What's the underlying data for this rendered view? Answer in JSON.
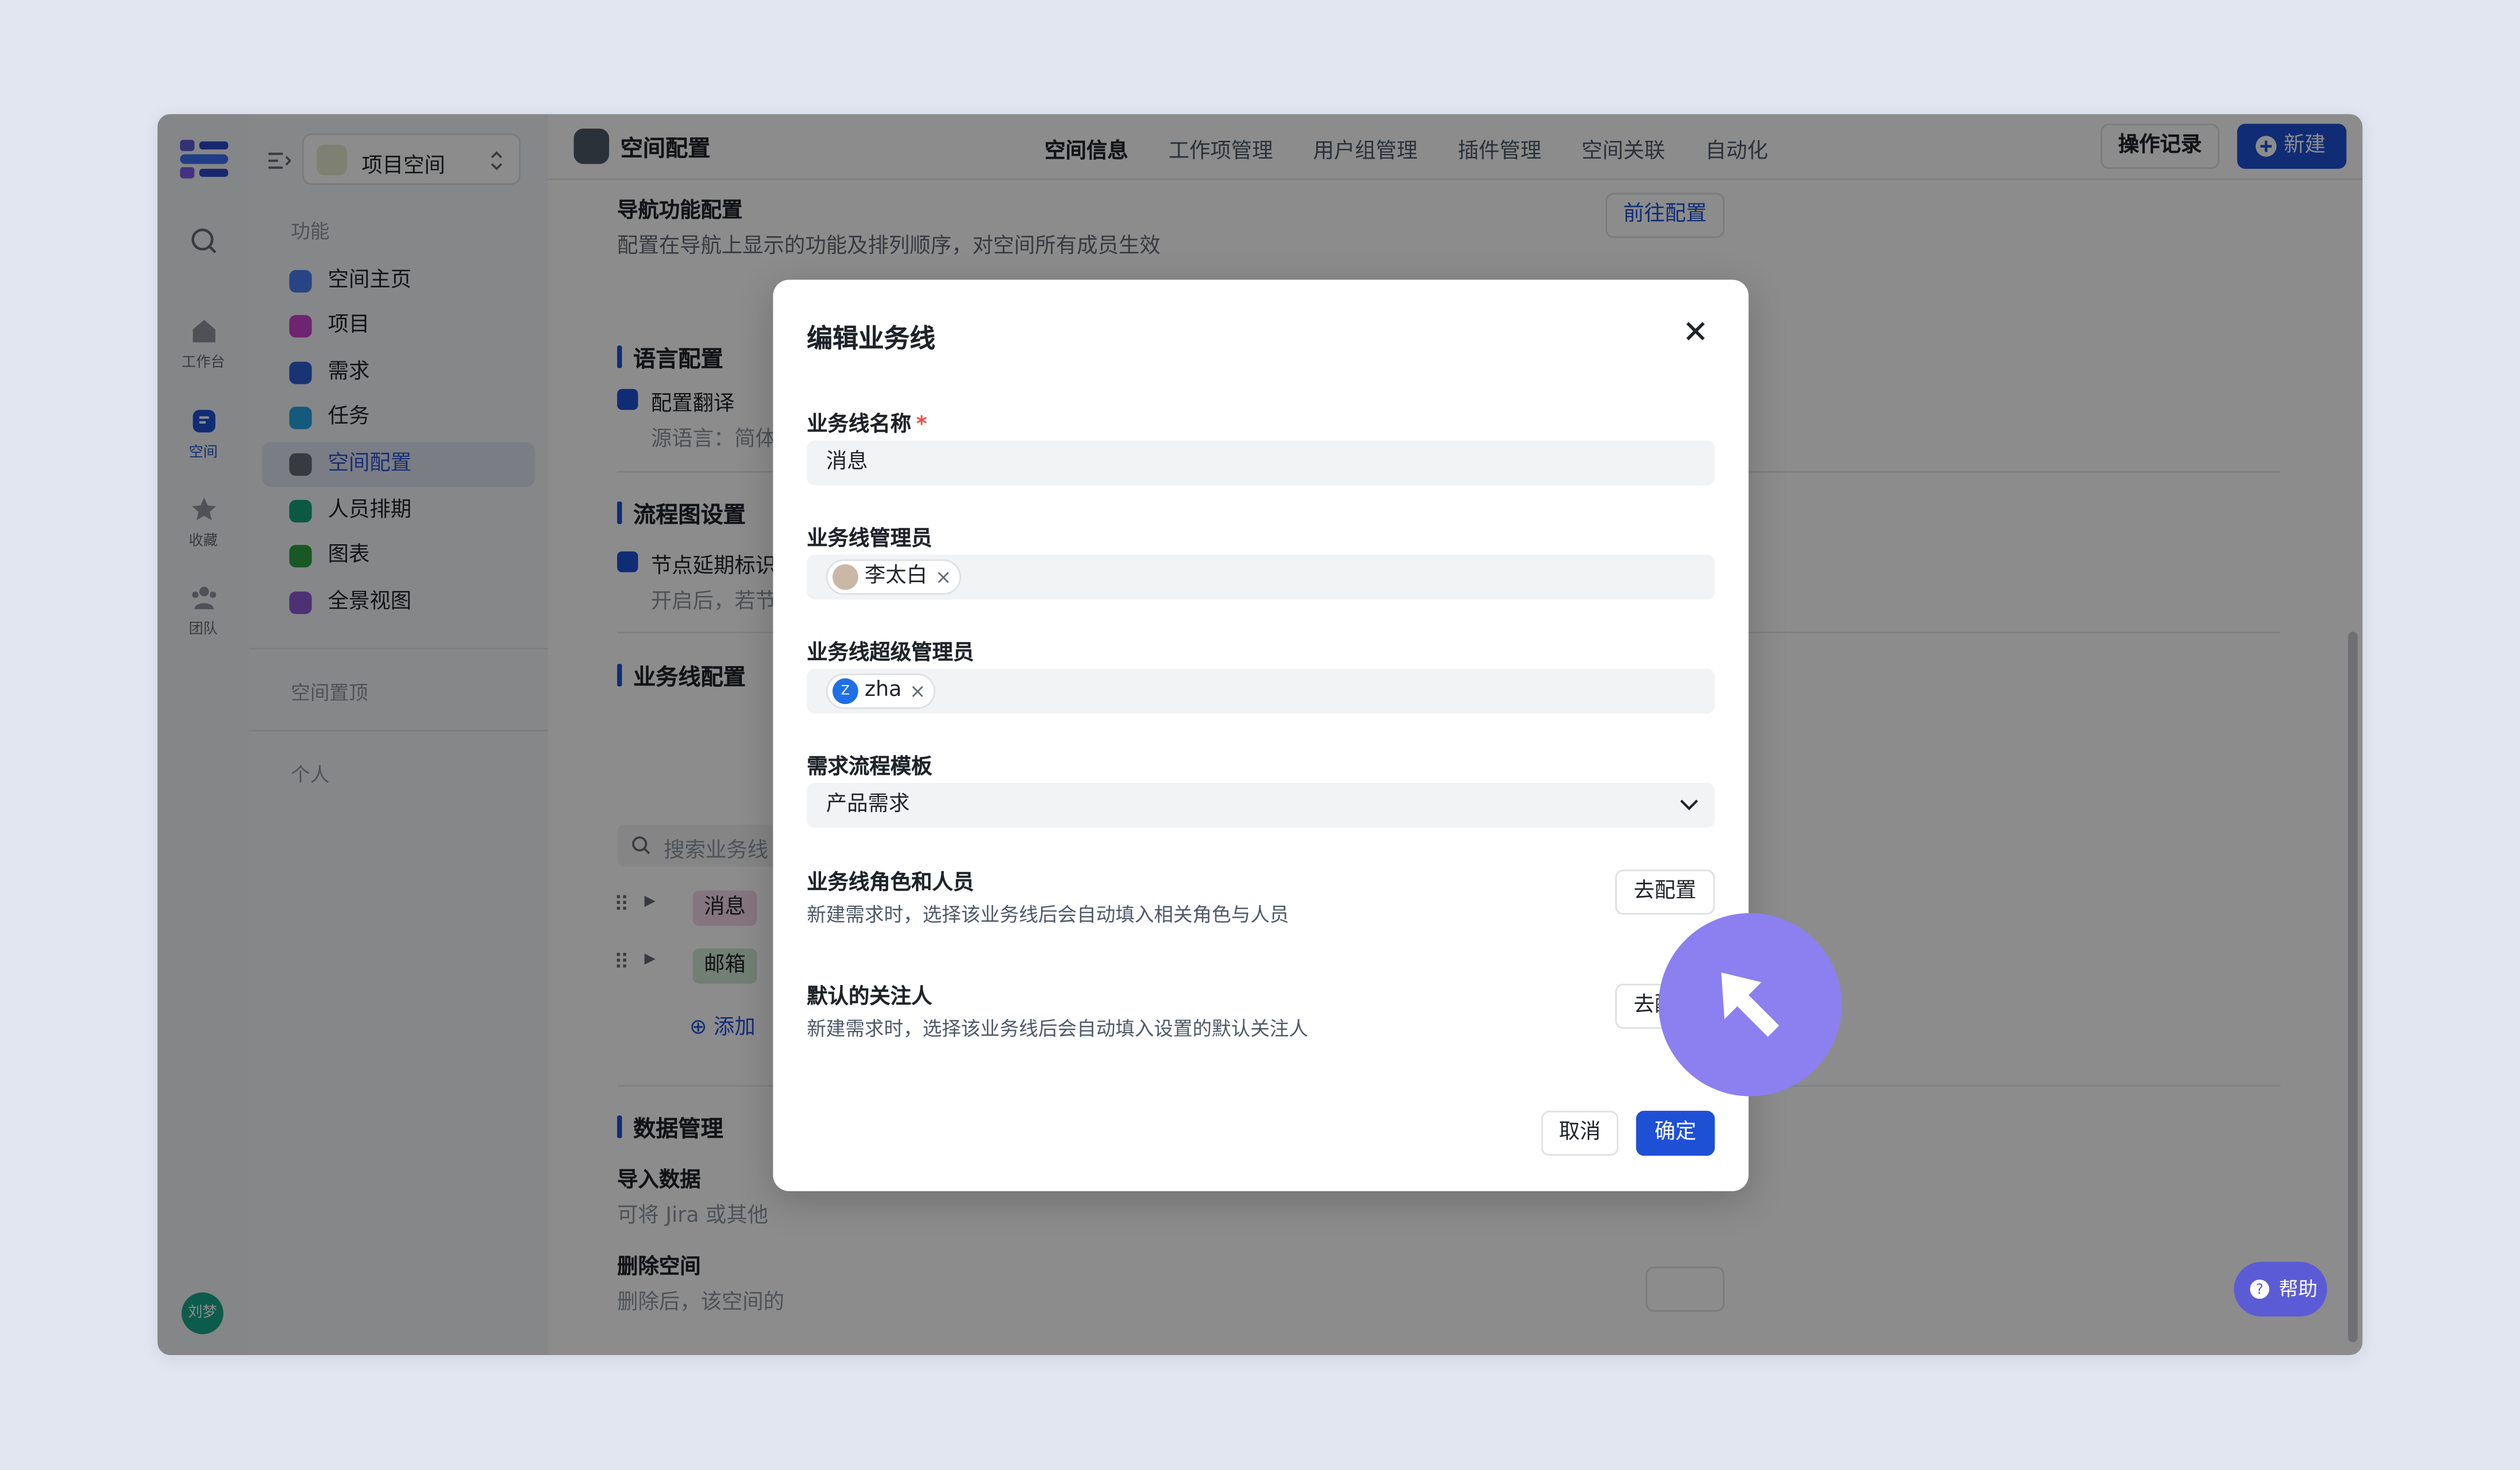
{
  "rail": {
    "items": [
      {
        "label": "",
        "icon": "search-icon"
      },
      {
        "label": "工作台",
        "icon": "home-icon"
      },
      {
        "label": "空间",
        "icon": "space-icon"
      },
      {
        "label": "收藏",
        "icon": "star-icon"
      },
      {
        "label": "团队",
        "icon": "team-icon"
      }
    ],
    "avatar": "刘梦"
  },
  "nav": {
    "space_name": "项目空间",
    "section_func": "功能",
    "items": [
      {
        "label": "空间主页",
        "color": "#4c7cf0"
      },
      {
        "label": "项目",
        "color": "#c843c8"
      },
      {
        "label": "需求",
        "color": "#2f5fd1"
      },
      {
        "label": "任务",
        "color": "#26a5e4"
      },
      {
        "label": "空间配置",
        "color": "#646a73"
      },
      {
        "label": "人员排期",
        "color": "#15a37a"
      },
      {
        "label": "图表",
        "color": "#2ea043"
      },
      {
        "label": "全景视图",
        "color": "#8b5cd6"
      }
    ],
    "section_pinned": "空间置顶",
    "section_personal": "个人"
  },
  "topbar": {
    "title": "空间配置",
    "tabs": [
      "空间信息",
      "工作项管理",
      "用户组管理",
      "插件管理",
      "空间关联",
      "自动化"
    ],
    "log_button": "操作记录",
    "new_button": "新建"
  },
  "content": {
    "nav_config_title": "导航功能配置",
    "nav_config_desc": "配置在导航上显示的功能及排列顺序，对空间所有成员生效",
    "nav_config_button": "前往配置",
    "lang_title": "语言配置",
    "lang_check": "配置翻译",
    "lang_source": "源语言：简体",
    "flow_title": "流程图设置",
    "flow_check": "节点延期标识",
    "flow_desc": "开启后，若节",
    "biz_title": "业务线配置",
    "biz_search": "搜索业务线",
    "biz_items": [
      "消息",
      "邮箱"
    ],
    "biz_add": "添加",
    "data_title": "数据管理",
    "import_title": "导入数据",
    "import_desc": "可将 Jira 或其他",
    "delete_title": "删除空间",
    "delete_desc": "删除后，该空间的"
  },
  "help": "帮助",
  "modal": {
    "title": "编辑业务线",
    "name_label": "业务线名称",
    "name_required": "*",
    "name_value": "消息",
    "admin_label": "业务线管理员",
    "admin_user": "李太白",
    "super_label": "业务线超级管理员",
    "super_user": "zha",
    "super_initial": "Z",
    "template_label": "需求流程模板",
    "template_value": "产品需求",
    "roles_title": "业务线角色和人员",
    "roles_desc": "新建需求时，选择该业务线后会自动填入相关角色与人员",
    "roles_button": "去配置",
    "watcher_title": "默认的关注人",
    "watcher_desc": "新建需求时，选择该业务线后会自动填入设置的默认关注人",
    "watcher_button": "去配置",
    "cancel": "取消",
    "confirm": "确定"
  }
}
